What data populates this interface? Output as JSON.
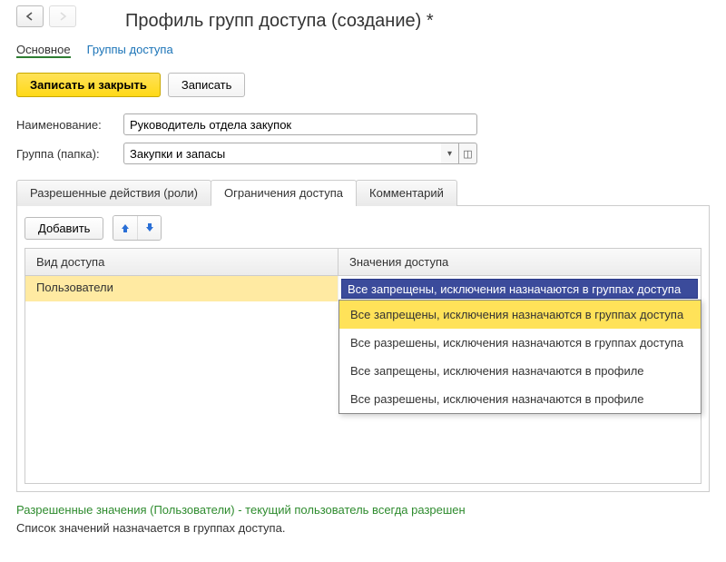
{
  "nav": {
    "back_enabled": true,
    "forward_enabled": false
  },
  "title": "Профиль групп доступа (создание) *",
  "sections": {
    "main": "Основное",
    "groups": "Группы доступа"
  },
  "commands": {
    "save_close": "Записать и закрыть",
    "save": "Записать"
  },
  "fields": {
    "name_label": "Наименование:",
    "name_value": "Руководитель отдела закупок",
    "group_label": "Группа (папка):",
    "group_value": "Закупки и запасы"
  },
  "tabs": {
    "roles": "Разрешенные действия (роли)",
    "restrictions": "Ограничения доступа",
    "comment": "Комментарий"
  },
  "toolbar": {
    "add": "Добавить"
  },
  "grid": {
    "col_kind": "Вид доступа",
    "col_values": "Значения доступа",
    "row_kind": "Пользователи",
    "row_value": "Все запрещены, исключения назначаются в группах доступа"
  },
  "dropdown": {
    "options": [
      "Все запрещены, исключения назначаются в группах доступа",
      "Все разрешены, исключения назначаются в группах доступа",
      "Все запрещены, исключения назначаются в профиле",
      "Все разрешены, исключения назначаются в профиле"
    ],
    "selected_index": 0
  },
  "footer": {
    "green": "Разрешенные значения (Пользователи) - текущий пользователь всегда разрешен",
    "black": "Список значений назначается в группах доступа."
  }
}
